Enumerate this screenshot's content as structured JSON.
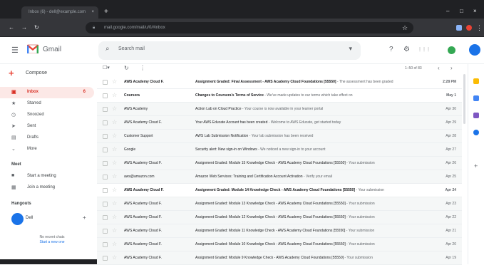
{
  "browser": {
    "tab_title": "Inbox (6) - dell@example.com",
    "tab_close": "×",
    "new_tab": "+",
    "window_buttons": [
      "–",
      "□",
      "×"
    ],
    "nav": [
      "←",
      "→",
      "↻"
    ],
    "url": "mail.google.com/mail/u/0/#inbox",
    "star": "☆"
  },
  "header": {
    "logo_text": "Gmail",
    "search_placeholder": "Search mail",
    "search_options": "▾",
    "icons": [
      "?",
      "⚙",
      "⋮⋮⋮"
    ]
  },
  "sidebar": {
    "compose": "Compose",
    "items": [
      {
        "icon": "▣",
        "label": "Inbox",
        "count": "6",
        "active": true
      },
      {
        "icon": "★",
        "label": "Starred",
        "count": ""
      },
      {
        "icon": "◷",
        "label": "Snoozed",
        "count": ""
      },
      {
        "icon": "➤",
        "label": "Sent",
        "count": ""
      },
      {
        "icon": "▤",
        "label": "Drafts",
        "count": ""
      },
      {
        "icon": "⌄",
        "label": "More",
        "count": ""
      }
    ],
    "meet_heading": "Meet",
    "meet_items": [
      {
        "icon": "■",
        "label": "Start a meeting"
      },
      {
        "icon": "▦",
        "label": "Join a meeting"
      }
    ],
    "hangouts_heading": "Hangouts",
    "hangouts_user": "Dell",
    "hangouts_add": "+",
    "hangouts_note": "No recent chats",
    "hangouts_link": "Start a new one"
  },
  "toolbar": {
    "select": "☐▾",
    "refresh": "↻",
    "more": "⋮",
    "pager": "1–50 of 83",
    "prev": "‹",
    "next": "›"
  },
  "emails": [
    {
      "sender": "AWS Academy Cloud F.",
      "subject": "Assignment Graded: Final Assessment - AWS Academy Cloud Foundations [55550]",
      "snippet": " - The assessment has been graded",
      "date": "2:28 PM",
      "unread": true
    },
    {
      "sender": "Coursera",
      "subject": "Changes to Coursera's Terms of Service",
      "snippet": " - We've made updates to our terms which take effect on",
      "date": "May 1",
      "unread": true
    },
    {
      "sender": "AWS Academy",
      "subject": "Action Lab on Cloud Practice",
      "snippet": " - Your course is now available in your learner portal",
      "date": "Apr 30",
      "unread": false
    },
    {
      "sender": "AWS Academy Cloud F.",
      "subject": "Your AWS Educate Account has been created",
      "snippet": " - Welcome to AWS Educate, get started today",
      "date": "Apr 29",
      "unread": false
    },
    {
      "sender": "Customer Support",
      "subject": "AWS Lab Submission Notification",
      "snippet": " - Your lab submission has been received",
      "date": "Apr 28",
      "unread": false
    },
    {
      "sender": "Google",
      "subject": "Security alert: New sign-in on Windows",
      "snippet": " - We noticed a new sign-in to your account",
      "date": "Apr 27",
      "unread": false
    },
    {
      "sender": "AWS Academy Cloud F.",
      "subject": "Assignment Graded: Module 15 Knowledge Check - AWS Academy Cloud Foundations [55550]",
      "snippet": " - Your submission",
      "date": "Apr 26",
      "unread": false
    },
    {
      "sender": "aws@amazon.com",
      "subject": "Amazon Web Services: Training and Certification Account Activation",
      "snippet": " - Verify your email",
      "date": "Apr 25",
      "unread": false
    },
    {
      "sender": "AWS Academy Cloud F.",
      "subject": "Assignment Graded: Module 14 Knowledge Check - AWS Academy Cloud Foundations [55550]",
      "snippet": " - Your submission",
      "date": "Apr 24",
      "unread": true
    },
    {
      "sender": "AWS Academy Cloud F.",
      "subject": "Assignment Graded: Module 13 Knowledge Check - AWS Academy Cloud Foundations [55550]",
      "snippet": " - Your submission",
      "date": "Apr 23",
      "unread": false
    },
    {
      "sender": "AWS Academy Cloud F.",
      "subject": "Assignment Graded: Module 12 Knowledge Check - AWS Academy Cloud Foundations [55550]",
      "snippet": " - Your submission",
      "date": "Apr 22",
      "unread": false
    },
    {
      "sender": "AWS Academy Cloud F.",
      "subject": "Assignment Graded: Module 11 Knowledge Check - AWS Academy Cloud Foundations [55550]",
      "snippet": " - Your submission",
      "date": "Apr 21",
      "unread": false
    },
    {
      "sender": "AWS Academy Cloud F.",
      "subject": "Assignment Graded: Module 10 Knowledge Check - AWS Academy Cloud Foundations [55550]",
      "snippet": " - Your submission",
      "date": "Apr 20",
      "unread": false
    },
    {
      "sender": "AWS Academy Cloud F.",
      "subject": "Assignment Graded: Module 9 Knowledge Check - AWS Academy Cloud Foundations [55550]",
      "snippet": " - Your submission",
      "date": "Apr 19",
      "unread": false
    }
  ],
  "right_panel": {
    "add": "+"
  },
  "colors": {
    "accent_red": "#d93025",
    "gmail_blue": "#1a73e8",
    "calendar_yellow": "#fbbc04",
    "keep_blue": "#4285f4",
    "tasks_purple": "#7e57c2",
    "apps_green": "#34a853"
  }
}
